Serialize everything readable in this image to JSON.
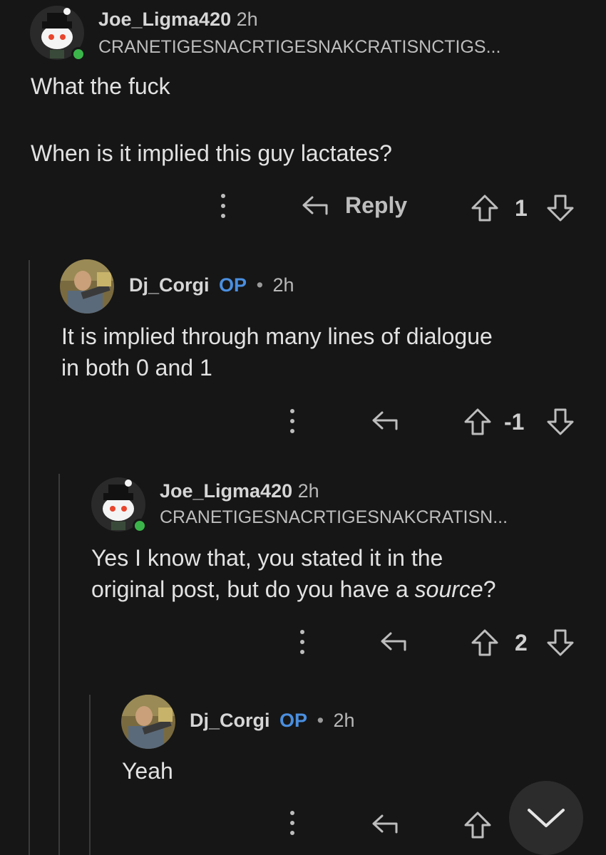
{
  "comments": [
    {
      "username": "Joe_Ligma420",
      "time": "2h",
      "flair": "CRANETIGESNACRTIGESNAKCRATISNCTIGS...",
      "body_lines": [
        "What the fuck",
        "When is it implied this guy lactates?"
      ],
      "reply_label": "Reply",
      "score": "1"
    },
    {
      "username": "Dj_Corgi",
      "op_badge": "OP",
      "separator": "•",
      "time": "2h",
      "body_lines": [
        "It is implied through many lines of dialogue",
        "in both 0 and 1"
      ],
      "score": "-1"
    },
    {
      "username": "Joe_Ligma420",
      "time": "2h",
      "flair": "CRANETIGESNACRTIGESNAKCRATISN...",
      "body_line_1": "Yes I know that, you stated it in the",
      "body_line_2_prefix": "original post, but do you have a ",
      "body_line_2_em": "source",
      "body_line_2_suffix": "?",
      "score": "2"
    },
    {
      "username": "Dj_Corgi",
      "op_badge": "OP",
      "separator": "•",
      "time": "2h",
      "body_lines": [
        "Yeah"
      ],
      "score": ""
    }
  ],
  "icons": {
    "more": "more-vertical-icon",
    "reply": "reply-arrow-icon",
    "upvote": "upvote-arrow-icon",
    "downvote": "downvote-arrow-icon",
    "scroll_down": "chevron-down-icon"
  },
  "colors": {
    "background": "#161616",
    "op_badge": "#4a8fe0",
    "online": "#3bb54a"
  }
}
